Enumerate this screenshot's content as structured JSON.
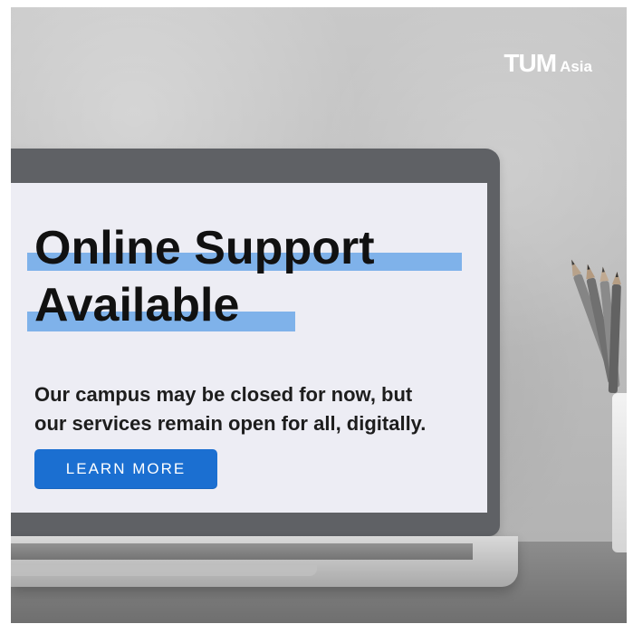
{
  "branding": {
    "mark": "TUM",
    "name": "Asia"
  },
  "hero": {
    "title_line_1": "Online Support",
    "title_line_2": "Available",
    "subtitle_line_1": "Our campus may be closed for now, but",
    "subtitle_line_2": "our services remain open for all, digitally.",
    "button_label": "LEARN MORE"
  },
  "colors": {
    "highlight": "#7fb2ea",
    "button": "#1b6fd1",
    "text_dark": "#111111",
    "wall": "#c3c3c3",
    "laptop": "#5f6165"
  },
  "icons": {
    "pencil_cup": "pencil-cup-icon"
  }
}
